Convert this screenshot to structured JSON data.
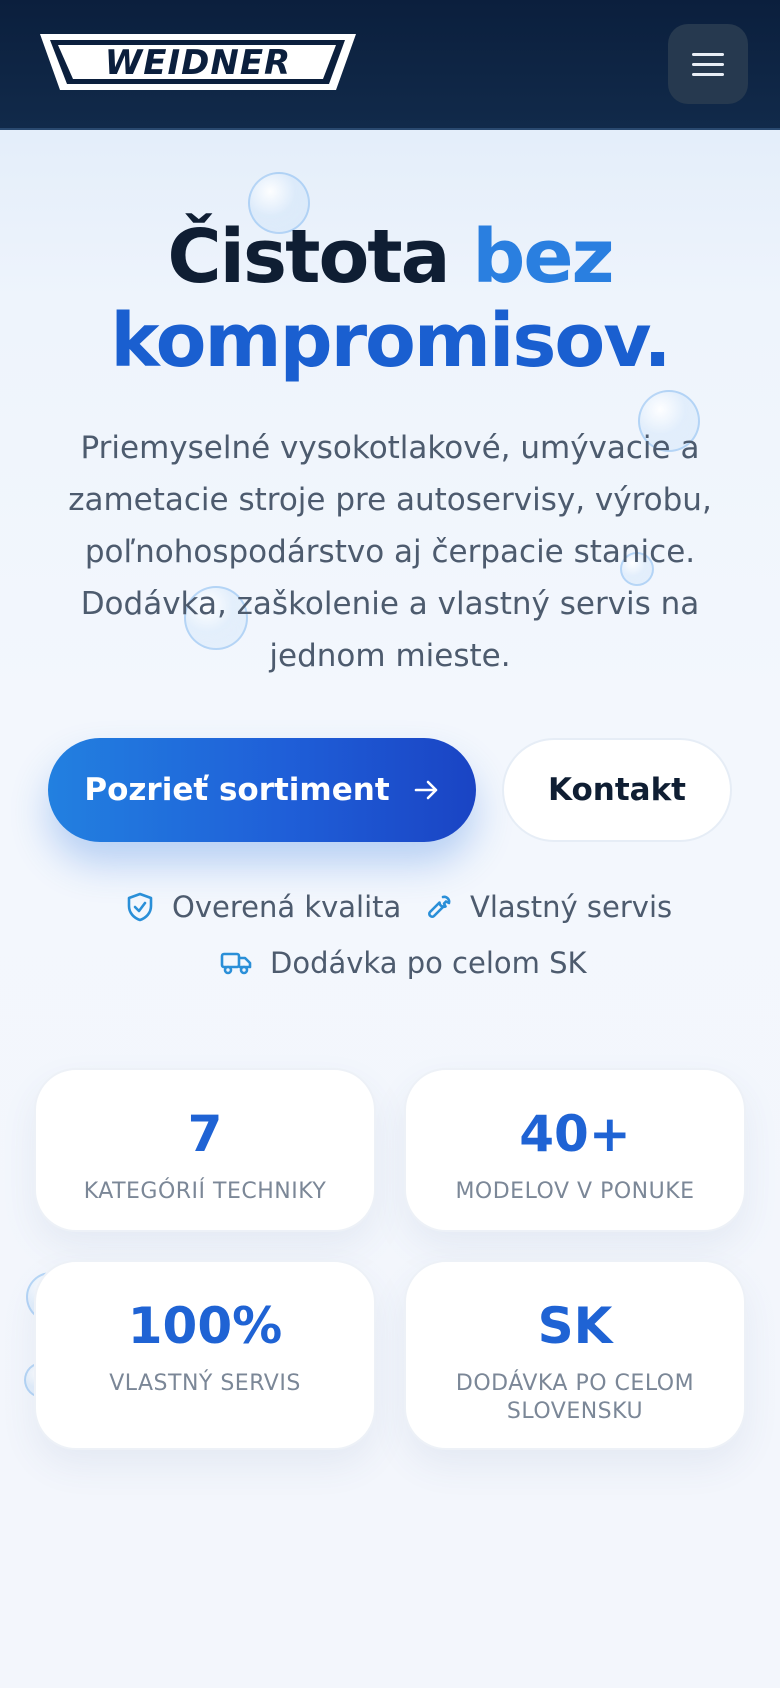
{
  "brand": {
    "logo_text": "WEIDNER"
  },
  "header": {
    "menu_icon": "hamburger-icon"
  },
  "hero": {
    "title_line1_dark": "Čistota",
    "title_line1_blue": "bez",
    "title_line2": "kompromisov.",
    "subtitle_lines": [
      "Priemyselné vysokotlakové, umývacie a",
      "zametacie stroje pre autoservisy, výrobu,",
      "poľnohospodárstvo aj čerpacie stanice.",
      "Dodávka, zaškolenie a vlastný servis na",
      "jednom mieste."
    ]
  },
  "cta": {
    "primary_label": "Pozrieť sortiment",
    "primary_icon": "arrow-right-icon",
    "secondary_label": "Kontakt"
  },
  "features": [
    {
      "icon": "shield-check-icon",
      "label": "Overená kvalita"
    },
    {
      "icon": "wrench-icon",
      "label": "Vlastný servis"
    },
    {
      "icon": "truck-icon",
      "label": "Dodávka po celom SK"
    }
  ],
  "stats": [
    {
      "value": "7",
      "label": "KATEGÓRIÍ TECHNIKY"
    },
    {
      "value": "40+",
      "label": "MODELOV V PONUKE"
    },
    {
      "value": "100%",
      "label": "VLASTNÝ SERVIS"
    },
    {
      "value": "SK",
      "label": "DODÁVKA PO CELOM SLOVENSKU"
    }
  ],
  "colors": {
    "header_bg": "#0b1f3d",
    "accent_blue": "#2a7fe0",
    "accent_blue_dark": "#1a44c4",
    "text_dark": "#0f1e33",
    "text_muted": "#4d5b6e",
    "stat_value": "#1f63d4",
    "feature_icon": "#2a8fd8"
  }
}
